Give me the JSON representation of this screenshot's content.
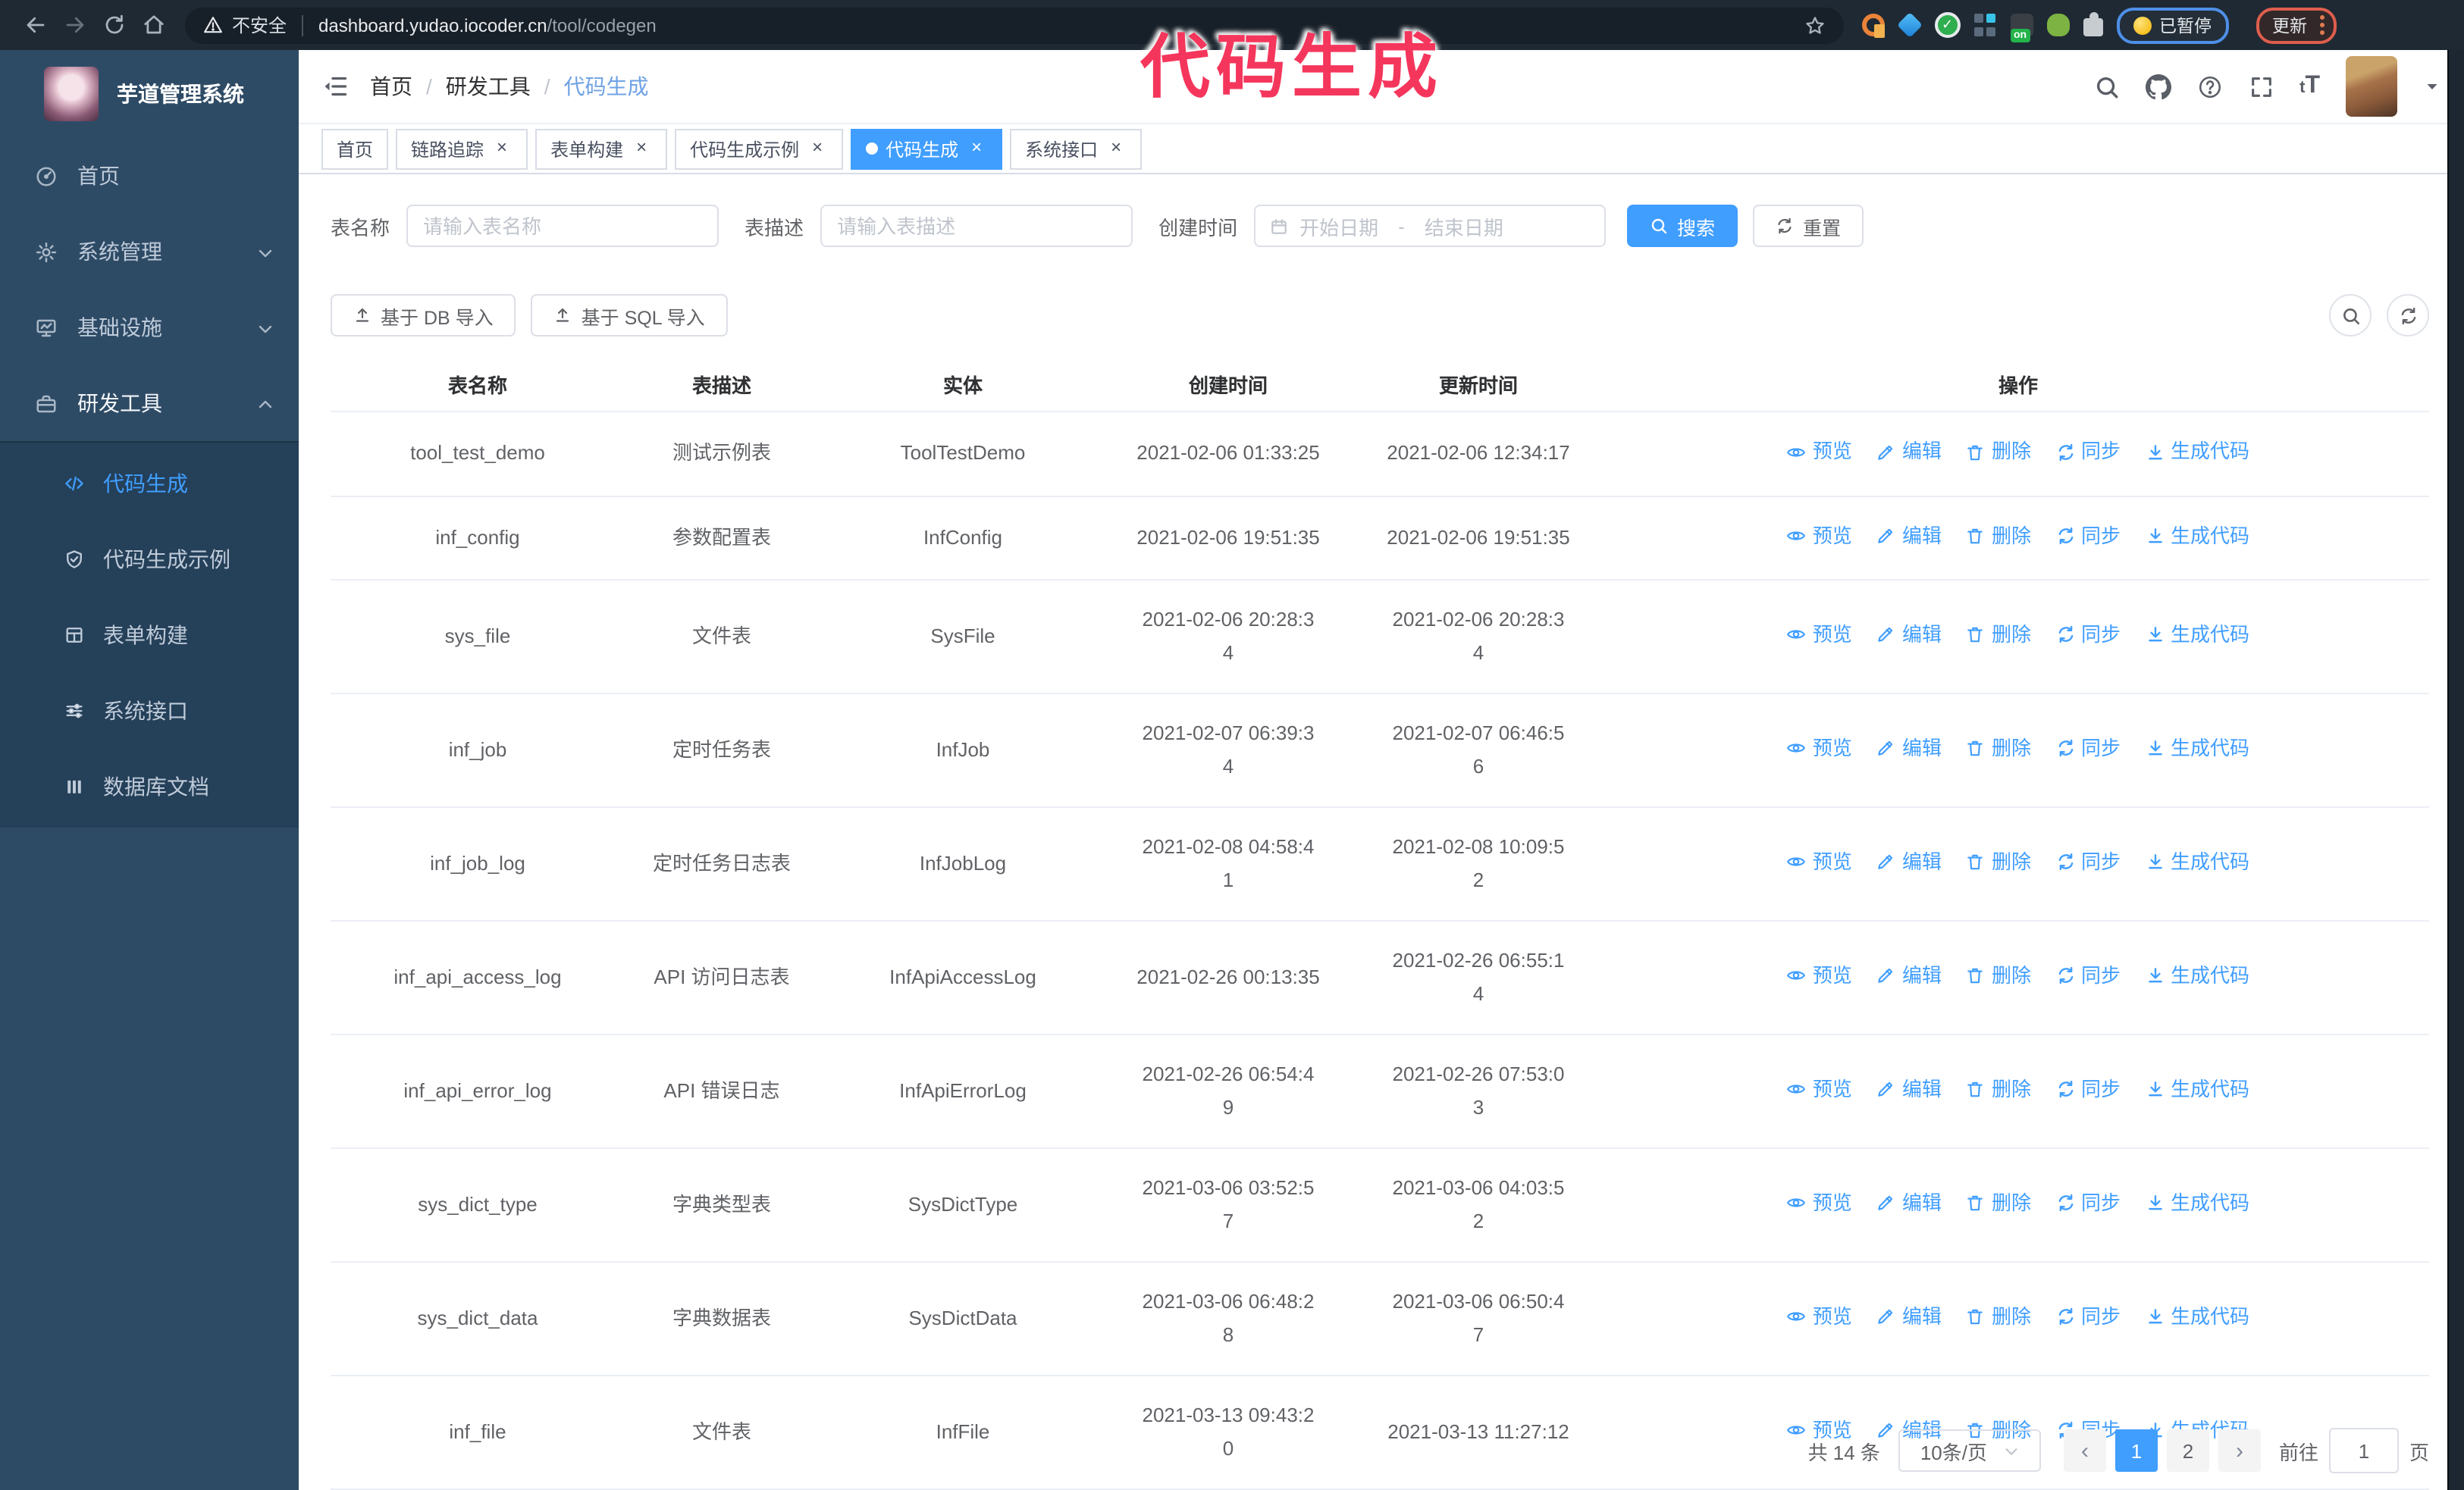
{
  "browser": {
    "security_label": "不安全",
    "url_domain": "dashboard.yudao.iocoder.cn",
    "url_path": "/tool/codegen",
    "paused_label": "已暂停",
    "update_label": "更新"
  },
  "annotation": {
    "text": "代码生成",
    "color": "#f5365c"
  },
  "sidebar": {
    "title": "芋道管理系统",
    "items": [
      {
        "key": "home",
        "label": "首页",
        "icon": "dashboard"
      },
      {
        "key": "system",
        "label": "系统管理",
        "icon": "gear",
        "chevron": "down"
      },
      {
        "key": "infra",
        "label": "基础设施",
        "icon": "monitor",
        "chevron": "down"
      },
      {
        "key": "devtools",
        "label": "研发工具",
        "icon": "toolbox",
        "chevron": "up",
        "active": true
      }
    ],
    "subitems": [
      {
        "key": "codegen",
        "label": "代码生成",
        "icon": "code",
        "active": true
      },
      {
        "key": "codegen-example",
        "label": "代码生成示例",
        "icon": "shield-check"
      },
      {
        "key": "form-builder",
        "label": "表单构建",
        "icon": "form"
      },
      {
        "key": "api",
        "label": "系统接口",
        "icon": "sliders"
      },
      {
        "key": "db-doc",
        "label": "数据库文档",
        "icon": "columns"
      }
    ]
  },
  "header": {
    "breadcrumb": [
      "首页",
      "研发工具",
      "代码生成"
    ]
  },
  "tabs": [
    {
      "key": "home",
      "label": "首页",
      "closable": false
    },
    {
      "key": "tracing",
      "label": "链路追踪",
      "closable": true
    },
    {
      "key": "form-builder",
      "label": "表单构建",
      "closable": true
    },
    {
      "key": "codegen-example",
      "label": "代码生成示例",
      "closable": true
    },
    {
      "key": "codegen",
      "label": "代码生成",
      "closable": true,
      "active": true
    },
    {
      "key": "api",
      "label": "系统接口",
      "closable": true
    }
  ],
  "filters": {
    "table_name_label": "表名称",
    "table_name_placeholder": "请输入表名称",
    "table_desc_label": "表描述",
    "table_desc_placeholder": "请输入表描述",
    "create_time_label": "创建时间",
    "start_placeholder": "开始日期",
    "range_separator": "-",
    "end_placeholder": "结束日期",
    "search_label": "搜索",
    "reset_label": "重置"
  },
  "toolbar": {
    "import_db_label": "基于 DB 导入",
    "import_sql_label": "基于 SQL 导入"
  },
  "table": {
    "columns": [
      "表名称",
      "表描述",
      "实体",
      "创建时间",
      "更新时间",
      "操作"
    ],
    "actions": [
      {
        "key": "preview",
        "label": "预览",
        "icon": "eye"
      },
      {
        "key": "edit",
        "label": "编辑",
        "icon": "edit"
      },
      {
        "key": "delete",
        "label": "删除",
        "icon": "trash"
      },
      {
        "key": "sync",
        "label": "同步",
        "icon": "refresh"
      },
      {
        "key": "generate",
        "label": "生成代码",
        "icon": "download"
      }
    ],
    "rows": [
      {
        "name": "tool_test_demo",
        "desc": "测试示例表",
        "entity": "ToolTestDemo",
        "created": "2021-02-06 01:33:25",
        "updated": "2021-02-06 12:34:17"
      },
      {
        "name": "inf_config",
        "desc": "参数配置表",
        "entity": "InfConfig",
        "created": "2021-02-06 19:51:35",
        "updated": "2021-02-06 19:51:35"
      },
      {
        "name": "sys_file",
        "desc": "文件表",
        "entity": "SysFile",
        "created": "2021-02-06 20:28:3\n4",
        "updated": "2021-02-06 20:28:3\n4"
      },
      {
        "name": "inf_job",
        "desc": "定时任务表",
        "entity": "InfJob",
        "created": "2021-02-07 06:39:3\n4",
        "updated": "2021-02-07 06:46:5\n6"
      },
      {
        "name": "inf_job_log",
        "desc": "定时任务日志表",
        "entity": "InfJobLog",
        "created": "2021-02-08 04:58:4\n1",
        "updated": "2021-02-08 10:09:5\n2"
      },
      {
        "name": "inf_api_access_log",
        "desc": "API 访问日志表",
        "entity": "InfApiAccessLog",
        "created": "2021-02-26 00:13:35",
        "updated": "2021-02-26 06:55:1\n4"
      },
      {
        "name": "inf_api_error_log",
        "desc": "API 错误日志",
        "entity": "InfApiErrorLog",
        "created": "2021-02-26 06:54:4\n9",
        "updated": "2021-02-26 07:53:0\n3"
      },
      {
        "name": "sys_dict_type",
        "desc": "字典类型表",
        "entity": "SysDictType",
        "created": "2021-03-06 03:52:5\n7",
        "updated": "2021-03-06 04:03:5\n2"
      },
      {
        "name": "sys_dict_data",
        "desc": "字典数据表",
        "entity": "SysDictData",
        "created": "2021-03-06 06:48:2\n8",
        "updated": "2021-03-06 06:50:4\n7"
      },
      {
        "name": "inf_file",
        "desc": "文件表",
        "entity": "InfFile",
        "created": "2021-03-13 09:43:2\n0",
        "updated": "2021-03-13 11:27:12"
      }
    ]
  },
  "pagination": {
    "total_label": "共 14 条",
    "page_size_label": "10条/页",
    "prev_label": "‹",
    "next_label": "›",
    "pages": [
      "1",
      "2"
    ],
    "active_page": "1",
    "goto_label": "前往",
    "goto_value": "1",
    "page_unit_label": "页"
  },
  "colors": {
    "accent": "#409eff",
    "annotation": "#f5365c",
    "sidebar_bg": "#2e4b66",
    "chrome_bg": "#1f2933"
  }
}
